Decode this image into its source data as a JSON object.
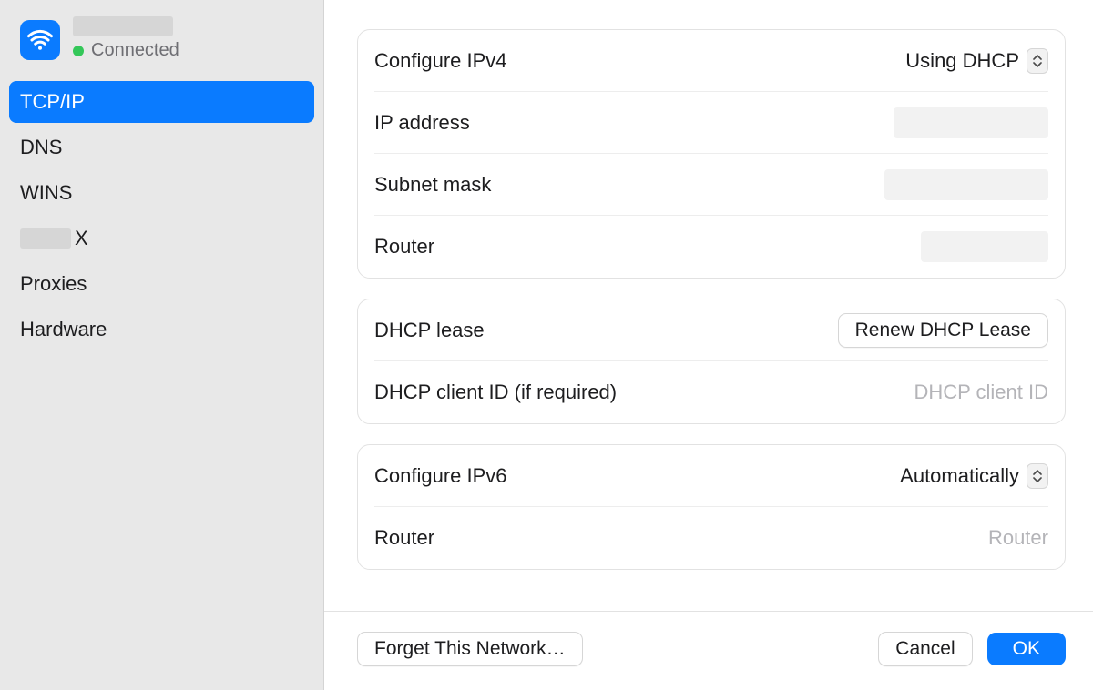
{
  "network": {
    "status_label": "Connected",
    "status_color": "#34c759"
  },
  "sidebar": {
    "items": [
      {
        "label": "TCP/IP",
        "selected": true
      },
      {
        "label": "DNS",
        "selected": false
      },
      {
        "label": "WINS",
        "selected": false
      },
      {
        "label_suffix": "X",
        "selected": false,
        "redacted_prefix": true
      },
      {
        "label": "Proxies",
        "selected": false
      },
      {
        "label": "Hardware",
        "selected": false
      }
    ]
  },
  "ipv4": {
    "configure_label": "Configure IPv4",
    "configure_value": "Using DHCP",
    "ip_label": "IP address",
    "subnet_label": "Subnet mask",
    "router_label": "Router"
  },
  "dhcp": {
    "lease_label": "DHCP lease",
    "renew_button": "Renew DHCP Lease",
    "client_id_label": "DHCP client ID (if required)",
    "client_id_placeholder": "DHCP client ID"
  },
  "ipv6": {
    "configure_label": "Configure IPv6",
    "configure_value": "Automatically",
    "router_label": "Router",
    "router_placeholder": "Router"
  },
  "footer": {
    "forget_label": "Forget This Network…",
    "cancel_label": "Cancel",
    "ok_label": "OK"
  },
  "colors": {
    "accent": "#0a7bff"
  }
}
